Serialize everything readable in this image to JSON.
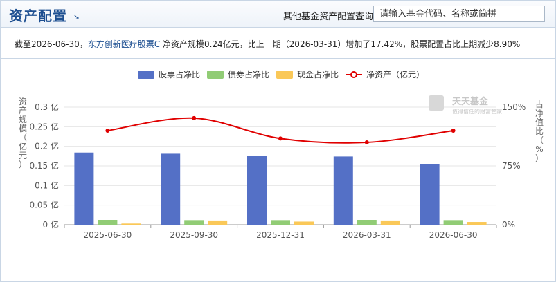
{
  "header": {
    "title": "资产配置",
    "title_arrow": "↘",
    "query_label": "其他基金资产配置查询:",
    "query_placeholder": "请输入基金代码、名称或简拼"
  },
  "summary": {
    "prefix": "截至2026-06-30，",
    "fund_link": "东方创新医疗股票C",
    "suffix": " 净资产规模0.24亿元，比上一期（2026-03-31）增加了17.42%，股票配置占比上期减少8.90%"
  },
  "watermark": {
    "name": "天天基金",
    "slogan": "值得信任的财富管家"
  },
  "chart_data": {
    "type": "bar",
    "categories": [
      "2025-06-30",
      "2025-09-30",
      "2025-12-31",
      "2026-03-31",
      "2026-06-30"
    ],
    "series": [
      {
        "name": "股票占净比",
        "color": "#5470c6",
        "values": [
          0.184,
          0.181,
          0.176,
          0.174,
          0.155
        ],
        "axis": "left"
      },
      {
        "name": "债券占净比",
        "color": "#91cc75",
        "values": [
          0.012,
          0.01,
          0.01,
          0.011,
          0.01
        ],
        "axis": "left"
      },
      {
        "name": "现金占净比",
        "color": "#fac858",
        "values": [
          0.003,
          0.009,
          0.008,
          0.009,
          0.007
        ],
        "axis": "left"
      }
    ],
    "line": {
      "name": "净资产（亿元）",
      "color": "#e00000",
      "values": [
        1.2,
        1.36,
        1.1,
        1.05,
        1.2
      ],
      "axis": "right"
    },
    "left_axis": {
      "label": "资产规模（亿元）",
      "ticks": [
        "0 亿",
        "0.05 亿",
        "0.1 亿",
        "0.15 亿",
        "0.2 亿",
        "0.25 亿",
        "0.3 亿"
      ],
      "ylim": [
        0,
        0.3
      ]
    },
    "right_axis": {
      "label": "占净值比（%）",
      "ticks": [
        "0%",
        "75%",
        "150%"
      ],
      "ylim": [
        0,
        1.5
      ]
    },
    "legend_position": "top-center",
    "grid": true
  }
}
